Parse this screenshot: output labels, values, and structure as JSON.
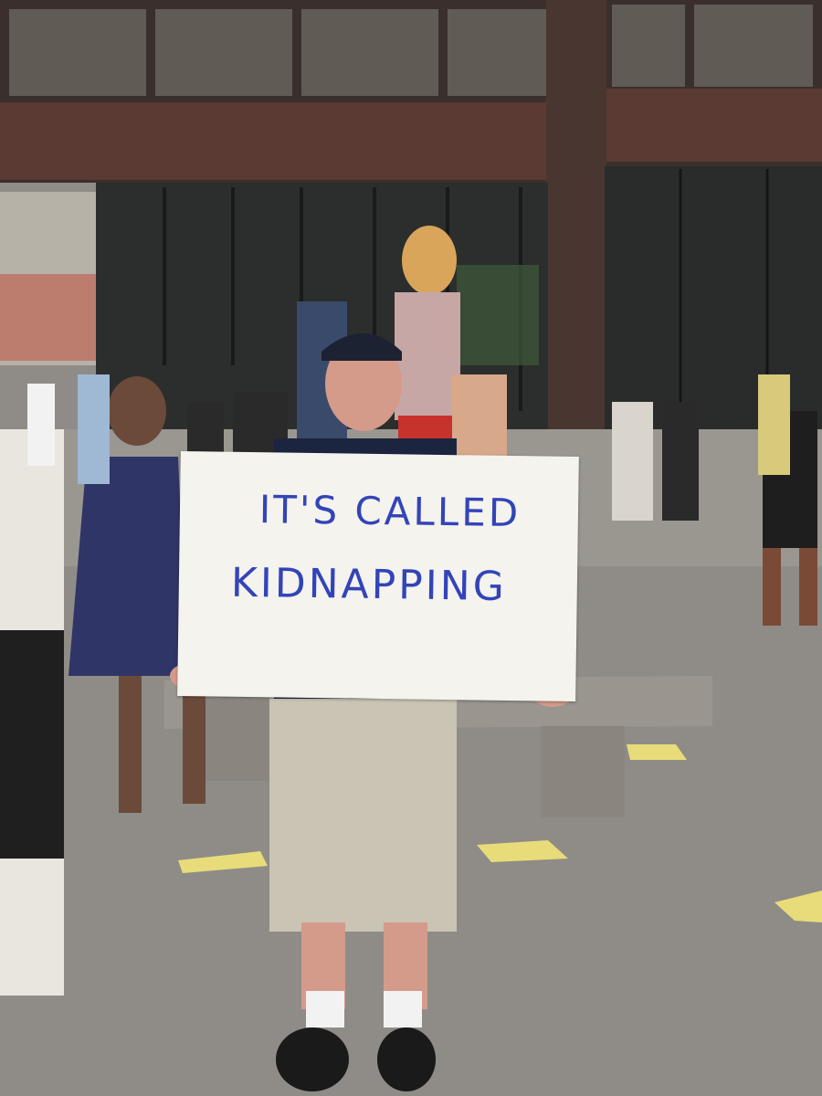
{
  "sign": {
    "line1": "IT'S CALLED",
    "line2": "KIDNAPPING"
  },
  "colors": {
    "sign_text": "#3344b8",
    "sign_board": "#f4f3ee",
    "plaza_floor": "#8f8c87",
    "building_facade": "#5a3a32"
  }
}
